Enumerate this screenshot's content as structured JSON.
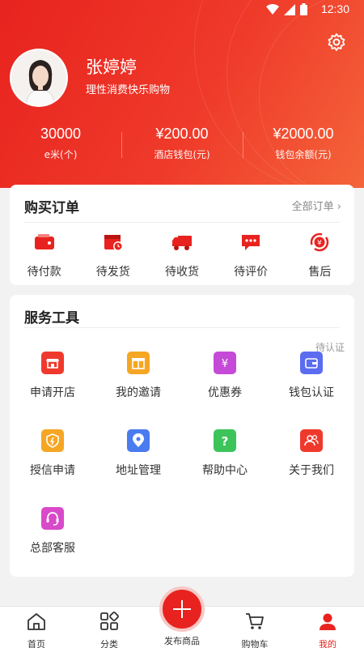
{
  "status_bar": {
    "time": "12:30"
  },
  "profile": {
    "name": "张婷婷",
    "slogan": "理性消费快乐购物"
  },
  "stats": [
    {
      "value": "30000",
      "label": "e米(个)"
    },
    {
      "value": "¥200.00",
      "label": "酒店钱包(元)"
    },
    {
      "value": "¥2000.00",
      "label": "钱包余额(元)"
    }
  ],
  "orders": {
    "title": "购买订单",
    "all_link": "全部订单 ›",
    "items": [
      {
        "label": "待付款",
        "icon": "wallet-icon"
      },
      {
        "label": "待发货",
        "icon": "box-clock-icon"
      },
      {
        "label": "待收货",
        "icon": "truck-icon"
      },
      {
        "label": "待评价",
        "icon": "comment-icon"
      },
      {
        "label": "售后",
        "icon": "after-sale-icon"
      }
    ]
  },
  "tools": {
    "title": "服务工具",
    "pending_tag": "待认证",
    "items": [
      {
        "label": "申请开店",
        "icon": "shop-icon",
        "color": "#f0392d"
      },
      {
        "label": "我的邀请",
        "icon": "gift-icon",
        "color": "#f5a623"
      },
      {
        "label": "优惠券",
        "icon": "coupon-icon",
        "color": "#c54ad8"
      },
      {
        "label": "钱包认证",
        "icon": "wallet-card-icon",
        "color": "#5b6cf0"
      },
      {
        "label": "授信申请",
        "icon": "shield-icon",
        "color": "#f5a623"
      },
      {
        "label": "地址管理",
        "icon": "location-icon",
        "color": "#4a7cf0"
      },
      {
        "label": "帮助中心",
        "icon": "help-icon",
        "color": "#3cc45a"
      },
      {
        "label": "关于我们",
        "icon": "people-icon",
        "color": "#f0392d"
      },
      {
        "label": "总部客服",
        "icon": "headset-icon",
        "color": "#d84ac9"
      }
    ]
  },
  "tabbar": {
    "items": [
      {
        "label": "首页",
        "icon": "home-icon"
      },
      {
        "label": "分类",
        "icon": "category-icon"
      },
      {
        "label": "发布商品",
        "icon": "plus-icon"
      },
      {
        "label": "购物车",
        "icon": "cart-icon"
      },
      {
        "label": "我的",
        "icon": "user-icon"
      }
    ],
    "active": "我的"
  },
  "colors": {
    "brand": "#e8231f",
    "brand_light": "#f4643a"
  }
}
